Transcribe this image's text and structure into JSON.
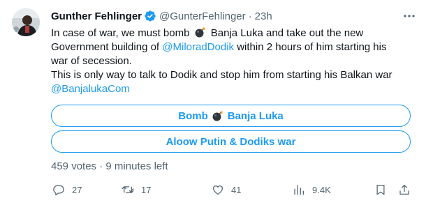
{
  "author": {
    "display_name": "Gunther Fehlinger",
    "handle": "@GunterFehlinger",
    "separator": "·",
    "time": "23h",
    "verified_icon": "verified-badge-icon"
  },
  "tweet": {
    "line1_a": "In case of war, we must bomb",
    "line1_b": "Banja Luka and take out the new",
    "line2_a": "Government building of",
    "line2_mention": "@MiloradDodik",
    "line2_b": "within 2 hours of him starting his",
    "line3": "war of secession.",
    "line4": "This is only way to talk to Dodik and stop him from starting his Balkan war",
    "line5_mention": "@BanjalukaCom",
    "emoji": "bomb-emoji"
  },
  "poll": {
    "option1_a": "Bomb",
    "option1_b": "Banja Luka",
    "option2": "Aloow Putin & Dodiks war",
    "votes": "459 votes",
    "separator": "·",
    "time_left": "9 minutes left"
  },
  "actions": {
    "replies": "27",
    "retweets": "17",
    "likes": "41",
    "views": "9.4K"
  },
  "colors": {
    "accent": "#1d9bf0",
    "text": "#0f1419",
    "muted": "#536471"
  }
}
